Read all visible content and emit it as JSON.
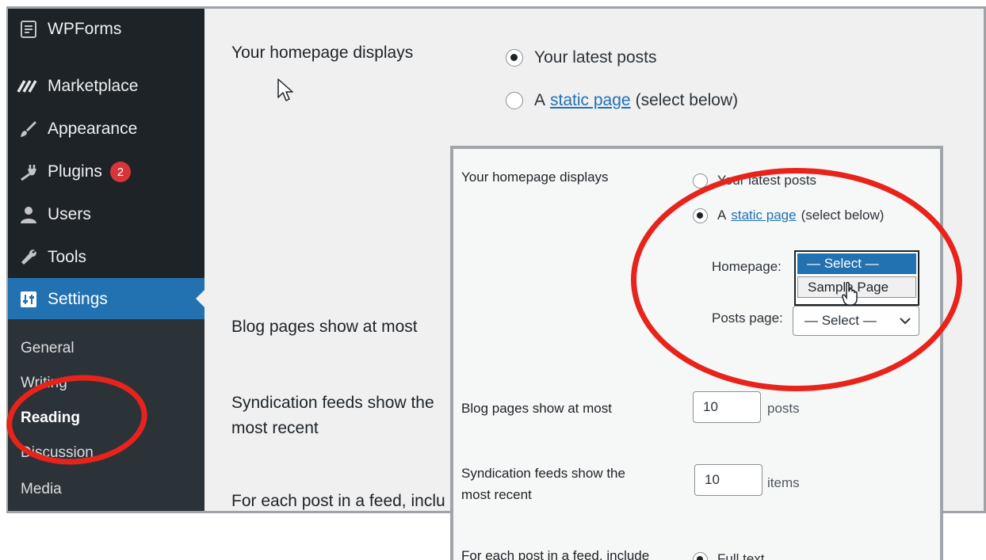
{
  "sidebar": {
    "items": [
      {
        "label": "WPForms",
        "icon": "wpforms-icon"
      },
      {
        "label": "Marketplace",
        "icon": "marketplace-icon"
      },
      {
        "label": "Appearance",
        "icon": "paintbrush-icon"
      },
      {
        "label": "Plugins",
        "icon": "plug-icon",
        "badge": "2"
      },
      {
        "label": "Users",
        "icon": "user-icon"
      },
      {
        "label": "Tools",
        "icon": "wrench-icon"
      },
      {
        "label": "Settings",
        "icon": "settings-icon",
        "active": true
      }
    ],
    "submenu": [
      "General",
      "Writing",
      "Reading",
      "Discussion",
      "Media"
    ],
    "current_submenu": "Reading"
  },
  "background_page": {
    "homepage_label": "Your homepage displays",
    "option_latest": "Your latest posts",
    "option_static_prefix": "A",
    "option_static_link": "static page",
    "option_static_suffix": "(select below)",
    "blog_pages_label": "Blog pages show at most",
    "syndication_label_line1": "Syndication feeds show the",
    "syndication_label_line2": "most recent",
    "feed_label": "For each post in a feed, inclu"
  },
  "inset": {
    "homepage_label": "Your homepage displays",
    "option_latest": "Your latest posts",
    "option_static_prefix": "A",
    "option_static_link": "static page",
    "option_static_suffix": "(select below)",
    "homepage_field_label": "Homepage:",
    "homepage_options": [
      "— Select —",
      "Sample Page"
    ],
    "posts_page_label": "Posts page:",
    "posts_page_value": "— Select —",
    "blog_pages_label": "Blog pages show at most",
    "blog_pages_value": "10",
    "blog_pages_unit": "posts",
    "syndication_label_line1": "Syndication feeds show the",
    "syndication_label_line2": "most recent",
    "syndication_value": "10",
    "syndication_unit": "items",
    "feed_label": "For each post in a feed, include",
    "feed_option": "Full text"
  },
  "colors": {
    "sidebar_bg": "#1d2327",
    "active_menu": "#2271b1",
    "annotation_red": "#e8231b",
    "badge_red": "#d63638",
    "link_blue": "#2271b1"
  }
}
